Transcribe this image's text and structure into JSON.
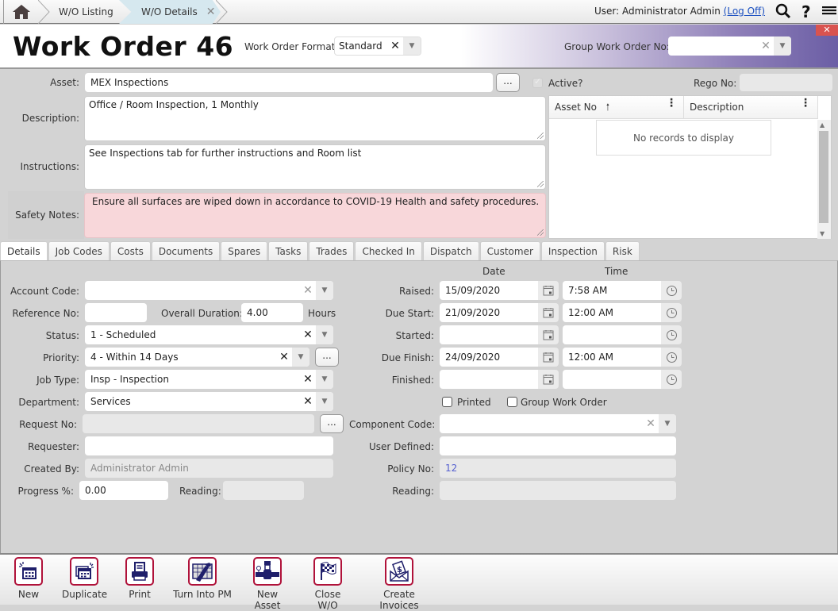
{
  "topbar": {
    "breadcrumbs": [
      {
        "label": "W/O Listing"
      },
      {
        "label": "W/O Details"
      }
    ],
    "user_prefix": "User: Administrator Admin",
    "logoff_label": "(Log Off)",
    "search_icon": "search-icon",
    "help_glyph": "?",
    "menu_icon": "hamburger-menu-icon"
  },
  "header": {
    "title": "Work Order 46",
    "format_label": "Work Order Format",
    "format_value": "Standard",
    "group_wo_label": "Group Work Order No:",
    "group_wo_value": "",
    "close_glyph": "✕"
  },
  "asset_section": {
    "asset_label": "Asset:",
    "asset_value": "MEX Inspections",
    "dots": "...",
    "active_label": "Active?",
    "active_checked": true,
    "rego_label": "Rego No:",
    "rego_value": "",
    "description_label": "Description:",
    "description_value": "Office / Room Inspection, 1 Monthly",
    "instructions_label": "Instructions:",
    "instructions_value": "See Inspections tab for further instructions and Room list",
    "safety_label": "Safety Notes:",
    "safety_value": "Ensure all surfaces are wiped down in accordance to COVID-19 Health and safety procedures."
  },
  "grid": {
    "columns": [
      {
        "label": "Asset No",
        "sort": "ascending"
      },
      {
        "label": "Description"
      }
    ],
    "empty_text": "No records to display"
  },
  "tabs": [
    {
      "label": "Details",
      "active": true
    },
    {
      "label": "Job Codes"
    },
    {
      "label": "Costs"
    },
    {
      "label": "Documents"
    },
    {
      "label": "Spares"
    },
    {
      "label": "Tasks"
    },
    {
      "label": "Trades"
    },
    {
      "label": "Checked In"
    },
    {
      "label": "Dispatch"
    },
    {
      "label": "Customer"
    },
    {
      "label": "Inspection"
    },
    {
      "label": "Risk"
    }
  ],
  "details": {
    "account_code": {
      "label": "Account Code:",
      "value": ""
    },
    "reference_no": {
      "label": "Reference No:",
      "value": ""
    },
    "overall_duration": {
      "label": "Overall Duration:",
      "value": "4.00",
      "unit": "Hours"
    },
    "status": {
      "label": "Status:",
      "value": "1 - Scheduled"
    },
    "priority": {
      "label": "Priority:",
      "value": "4 - Within 14 Days"
    },
    "job_type": {
      "label": "Job Type:",
      "value": "Insp - Inspection"
    },
    "department": {
      "label": "Department:",
      "value": "Services"
    },
    "request_no": {
      "label": "Request No:",
      "value": ""
    },
    "requester": {
      "label": "Requester:",
      "value": ""
    },
    "created_by": {
      "label": "Created By:",
      "value": "Administrator Admin"
    },
    "progress": {
      "label": "Progress %:",
      "value": "0.00"
    },
    "reading_left": {
      "label": "Reading:",
      "value": ""
    },
    "date_header": "Date",
    "time_header": "Time",
    "dates": [
      {
        "label": "Raised:",
        "date": "15/09/2020",
        "time": "7:58 AM"
      },
      {
        "label": "Due Start:",
        "date": "21/09/2020",
        "time": "12:00 AM"
      },
      {
        "label": "Started:",
        "date": "",
        "time": ""
      },
      {
        "label": "Due Finish:",
        "date": "24/09/2020",
        "time": "12:00 AM"
      },
      {
        "label": "Finished:",
        "date": "",
        "time": ""
      }
    ],
    "printed": {
      "label": "Printed",
      "checked": false
    },
    "group_work_order": {
      "label": "Group Work Order",
      "checked": false
    },
    "component_code": {
      "label": "Component Code:",
      "value": ""
    },
    "user_defined": {
      "label": "User Defined:",
      "value": ""
    },
    "policy_no": {
      "label": "Policy No:",
      "value": "12"
    },
    "reading_right": {
      "label": "Reading:",
      "value": ""
    }
  },
  "footer": {
    "buttons": [
      {
        "label": "New",
        "icon": "new-calendar-icon"
      },
      {
        "label": "Duplicate",
        "icon": "duplicate-calendar-icon"
      },
      {
        "label": "Print",
        "icon": "printer-icon"
      },
      {
        "label": "Turn Into PM",
        "icon": "turn-into-pm-icon"
      },
      {
        "label": "New Asset",
        "icon": "new-asset-pipe-icon"
      },
      {
        "label": "Close W/O",
        "icon": "checkered-flag-icon"
      },
      {
        "label": "Create Invoices",
        "icon": "invoice-envelope-icon"
      }
    ]
  },
  "colors": {
    "accent_border": "#b0123a",
    "icon_navy": "#1f1f6b",
    "safety_bg": "#f8d7da",
    "close_red": "#d9534f",
    "header_purple": "#6b5ea5",
    "link_blue": "#1a4fc0",
    "policy_blue": "#5560d0"
  }
}
